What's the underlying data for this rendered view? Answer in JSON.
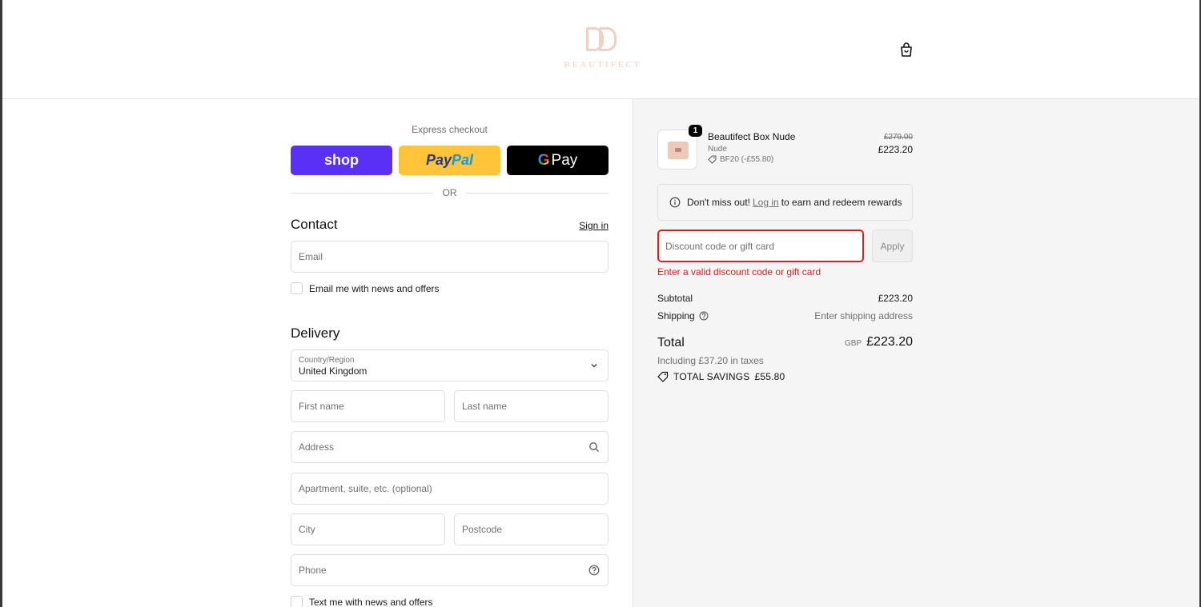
{
  "brand": {
    "name": "BEAUTIFECT",
    "color": "#f0cfc5"
  },
  "express": {
    "title": "Express checkout",
    "shop_label": "shop",
    "paypal_label_1": "Pay",
    "paypal_label_2": "Pal",
    "gpay_g": "G",
    "gpay_label": "Pay",
    "or_label": "OR"
  },
  "contact": {
    "heading": "Contact",
    "signin_label": "Sign in",
    "email_placeholder": "Email",
    "newsletter_label": "Email me with news and offers"
  },
  "delivery": {
    "heading": "Delivery",
    "country_label": "Country/Region",
    "country_value": "United Kingdom",
    "first_name_placeholder": "First name",
    "last_name_placeholder": "Last name",
    "address_placeholder": "Address",
    "apartment_placeholder": "Apartment, suite, etc. (optional)",
    "city_placeholder": "City",
    "postcode_placeholder": "Postcode",
    "phone_placeholder": "Phone",
    "sms_label": "Text me with news and offers"
  },
  "summary": {
    "item": {
      "quantity": "1",
      "name": "Beautifect Box Nude",
      "variant": "Nude",
      "discount": "BF20 (-£55.80)",
      "price_original": "£279.00",
      "price_final": "£223.20"
    },
    "rewards": {
      "prefix": "Don't miss out!",
      "login_link": "Log in",
      "suffix": "to earn and redeem rewards"
    },
    "discount_placeholder": "Discount code or gift card",
    "apply_label": "Apply",
    "error_text": "Enter a valid discount code or gift card",
    "subtotal_label": "Subtotal",
    "subtotal_value": "£223.20",
    "shipping_label": "Shipping",
    "shipping_value": "Enter shipping address",
    "total_label": "Total",
    "total_currency": "GBP",
    "total_value": "£223.20",
    "taxes_text": "Including £37.20 in taxes",
    "savings_label": "TOTAL SAVINGS",
    "savings_value": "£55.80"
  },
  "colors": {
    "error": "#dd1d1d",
    "shop_pay": "#5a31f4",
    "paypal": "#ffc439",
    "gpay": "#000000",
    "sidebar_bg": "#f5f5f5"
  },
  "icons": [
    "bag-icon",
    "chevron-down-icon",
    "search-icon",
    "help-circle-icon",
    "info-icon",
    "tag-icon"
  ]
}
